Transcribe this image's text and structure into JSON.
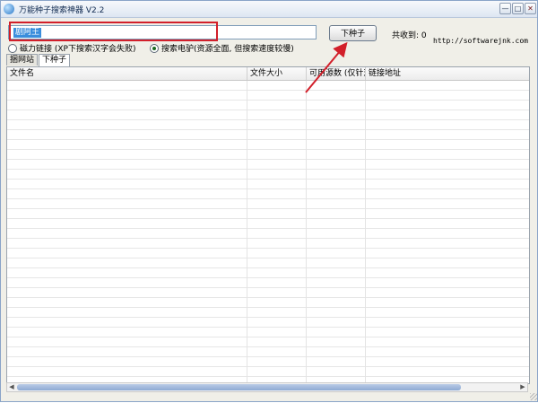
{
  "window": {
    "title": "万能种子搜索神器 V2.2",
    "controls": {
      "minimize": "—",
      "maximize": "□",
      "close": "✕"
    }
  },
  "search": {
    "value": "",
    "selected_hint": "剧阿王",
    "button_label": "下种子"
  },
  "stats": {
    "total_label": "共收到: 0"
  },
  "site_url": "http://softwarejnk.com",
  "radio_options": [
    {
      "label": "磁力链接 (XP下搜索汉字会失败)",
      "checked": false
    },
    {
      "label": "搜索电驴(资源全面, 但搜索速度较慢)",
      "checked": true
    }
  ],
  "tabs": [
    {
      "label": "捆网站",
      "active": false
    },
    {
      "label": "下种子",
      "active": true
    }
  ],
  "table": {
    "columns": [
      "文件名",
      "文件大小",
      "可用源数 (仅针对",
      "链接地址"
    ]
  },
  "colors": {
    "highlight": "#d21f2a",
    "title_bar": "#dde6f2",
    "selection": "#3a8edc"
  }
}
